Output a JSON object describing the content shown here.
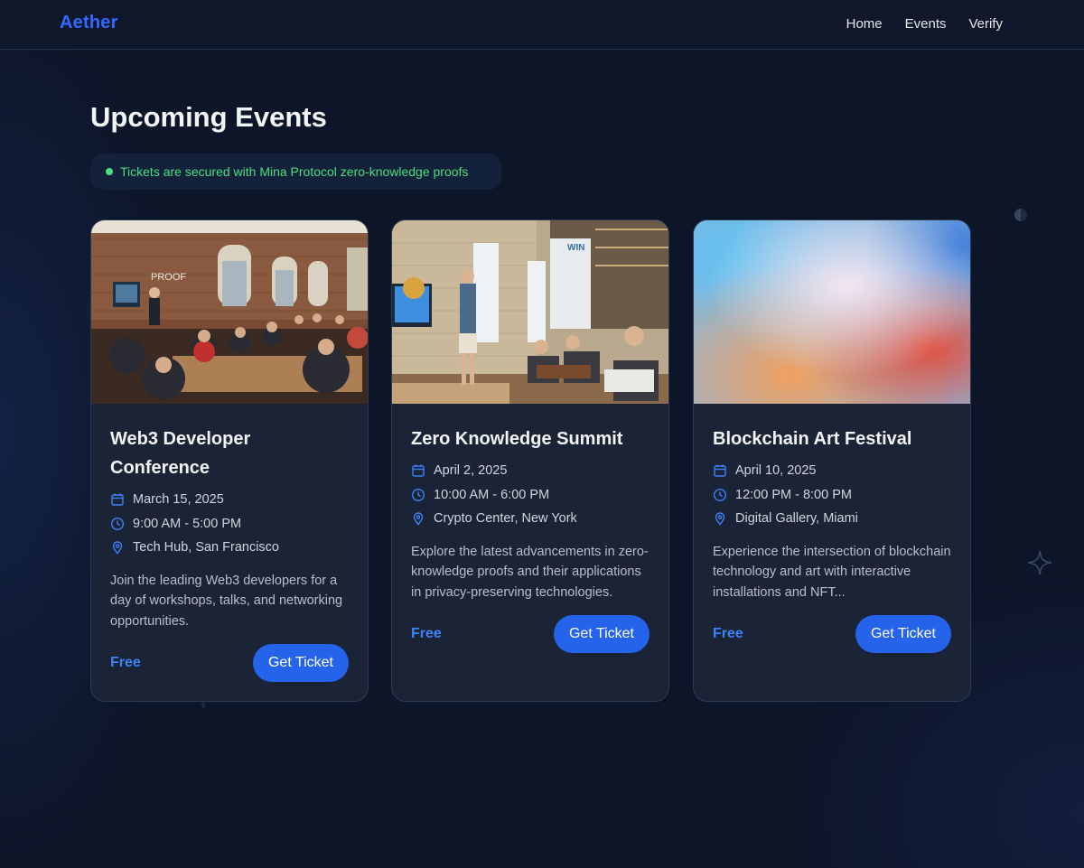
{
  "nav": {
    "brand": "Aether",
    "links": [
      "Home",
      "Events",
      "Verify"
    ]
  },
  "page": {
    "title": "Upcoming Events",
    "notice": "Tickets are secured with Mina Protocol zero-knowledge proofs"
  },
  "colors": {
    "accent": "#2563eb",
    "brand": "#2f6bff",
    "notice_green": "#4ade80",
    "price_blue": "#3b82f6"
  },
  "icons": {
    "date": "calendar-icon",
    "time": "clock-icon",
    "location": "map-pin-icon"
  },
  "events": [
    {
      "title": "Web3 Developer Conference",
      "date": "March 15, 2025",
      "time": "9:00 AM - 5:00 PM",
      "location": "Tech Hub, San Francisco",
      "description": "Join the leading Web3 developers for a day of workshops, talks, and networking opportunities.",
      "price": "Free",
      "button": "Get Ticket"
    },
    {
      "title": "Zero Knowledge Summit",
      "date": "April 2, 2025",
      "time": "10:00 AM - 6:00 PM",
      "location": "Crypto Center, New York",
      "description": "Explore the latest advancements in zero-knowledge proofs and their applications in privacy-preserving technologies.",
      "price": "Free",
      "button": "Get Ticket"
    },
    {
      "title": "Blockchain Art Festival",
      "date": "April 10, 2025",
      "time": "12:00 PM - 8:00 PM",
      "location": "Digital Gallery, Miami",
      "description": "Experience the intersection of blockchain technology and art with interactive installations and NFT...",
      "price": "Free",
      "button": "Get Ticket"
    }
  ]
}
